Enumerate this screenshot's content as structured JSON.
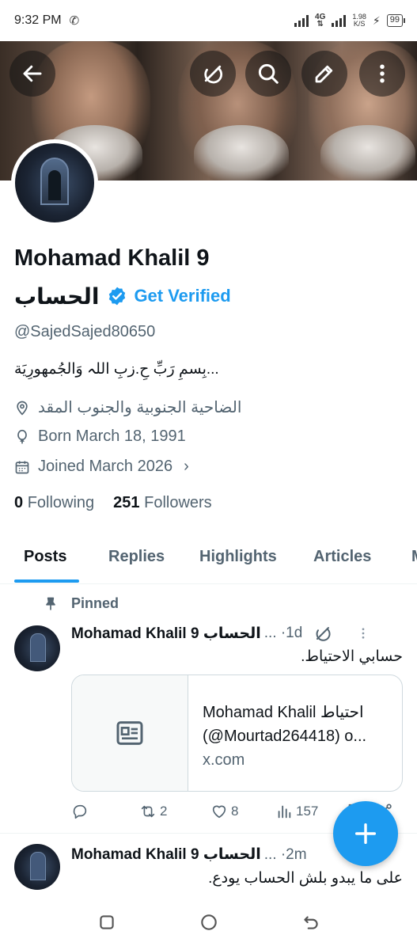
{
  "status": {
    "time": "9:32 PM",
    "network": "4G",
    "speed_value": "1.98",
    "speed_unit": "K/S",
    "battery": "99"
  },
  "header": {
    "back_icon": "arrow-left-icon",
    "grok_icon": "slash-circle-icon",
    "search_icon": "search-icon",
    "edit_icon": "pencil-icon",
    "more_icon": "more-vertical-icon"
  },
  "profile": {
    "name": "Mohamad Khalil 9",
    "name_line2": "الحساب",
    "get_verified": "Get Verified",
    "handle": "@SajedSajed80650",
    "bio": "بِسمِ رَبِّ حِ.زبِ اللہ وَالجُمهورِیَة...",
    "location": "الضاحية الجنوبية والجنوب المقد",
    "born": "Born March 18, 1991",
    "joined": "Joined March 2026",
    "following_count": "0",
    "following_label": "Following",
    "followers_count": "251",
    "followers_label": "Followers",
    "accent": "#1d9bf0"
  },
  "tabs": [
    "Posts",
    "Replies",
    "Highlights",
    "Articles",
    "M"
  ],
  "posts": [
    {
      "pinned_label": "Pinned",
      "author": "Mohamad Khalil 9 الحساب",
      "meta": "... ·1d",
      "text": "حسابي الاحتياط.",
      "card": {
        "title": "Mohamad Khalil احتياط",
        "subtitle": "(@Mourtad264418) o...",
        "domain": "x.com"
      },
      "replies": "",
      "reposts": "2",
      "likes": "8",
      "views": "157"
    },
    {
      "author": "Mohamad Khalil 9 الحساب",
      "meta": "... ·2m",
      "text": "على ما يبدو بلش الحساب يودع."
    }
  ],
  "nav": {
    "recents": "recents-icon",
    "home": "home-icon",
    "back": "back-icon"
  }
}
